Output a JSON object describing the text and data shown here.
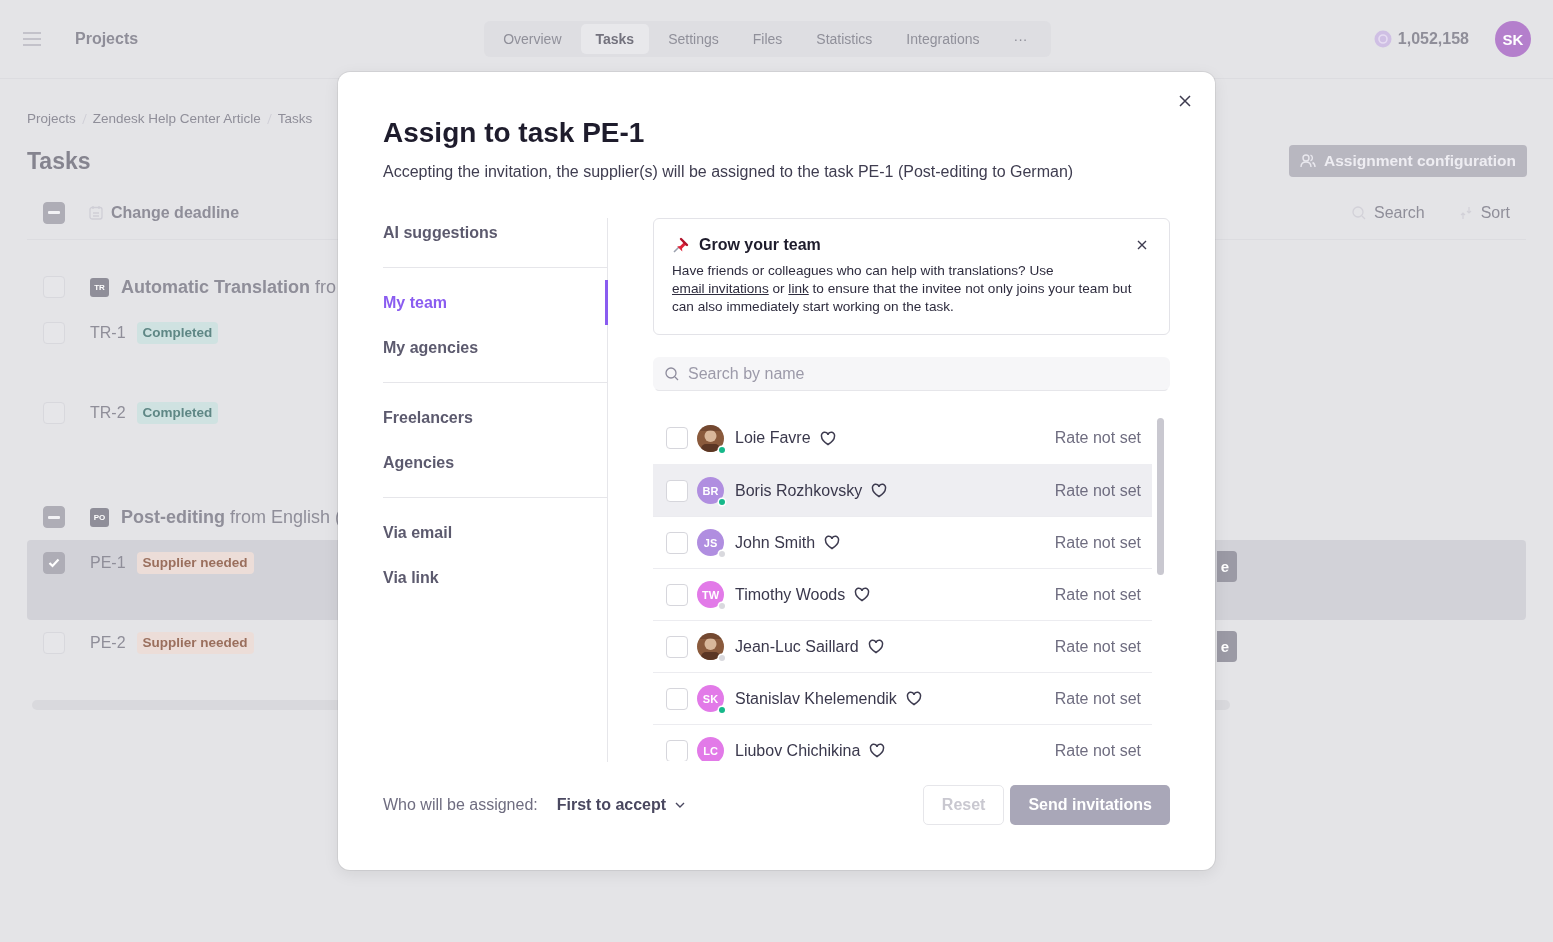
{
  "top_bar": {
    "title": "Projects",
    "tabs": [
      {
        "label": "Overview",
        "selected": false
      },
      {
        "label": "Tasks",
        "selected": true
      },
      {
        "label": "Settings",
        "selected": false
      },
      {
        "label": "Files",
        "selected": false
      },
      {
        "label": "Statistics",
        "selected": false
      },
      {
        "label": "Integrations",
        "selected": false
      },
      {
        "label": "···",
        "selected": false
      }
    ],
    "balance": "1,052,158",
    "avatar": "SK"
  },
  "breadcrumbs": [
    "Projects",
    "Zendesk Help Center Article",
    "Tasks"
  ],
  "page_title": "Tasks",
  "assignment_button": "Assignment configuration",
  "toolbar": {
    "indeterminate": true,
    "action": "Change deadline",
    "search": "Search",
    "sort": "Sort"
  },
  "groups": [
    {
      "badge": "TR",
      "title": "**Automatic Translation** fro",
      "indeterminate": false,
      "rows": [
        {
          "id": "TR-1",
          "status": {
            "text": "Completed",
            "kind": "completed"
          },
          "checked": false,
          "selected": false
        },
        {
          "id": "TR-2",
          "status": {
            "text": "Completed",
            "kind": "completed"
          },
          "checked": false,
          "selected": false
        }
      ]
    },
    {
      "badge": "PO",
      "title": "**Post-editing** from English (",
      "indeterminate": true,
      "rows": [
        {
          "id": "PE-1",
          "status": {
            "text": "Supplier needed",
            "kind": "needed"
          },
          "checked": true,
          "selected": true,
          "button": "e"
        },
        {
          "id": "PE-2",
          "status": {
            "text": "Supplier needed",
            "kind": "needed"
          },
          "checked": false,
          "selected": false,
          "button": "e"
        }
      ]
    }
  ],
  "dialog": {
    "title": "Assign to task PE-1",
    "subtitle": "Accepting the invitation, the supplier(s) will be assigned to the task PE-1 (Post-editing to German)",
    "nav_sections": [
      {
        "items": [
          {
            "label": "AI suggestions",
            "selected": false
          }
        ]
      },
      {
        "items": [
          {
            "label": "My team",
            "selected": true
          },
          {
            "label": "My agencies",
            "selected": false
          }
        ]
      },
      {
        "items": [
          {
            "label": "Freelancers",
            "selected": false
          },
          {
            "label": "Agencies",
            "selected": false
          }
        ]
      },
      {
        "items": [
          {
            "label": "Via email",
            "selected": false
          },
          {
            "label": "Via link",
            "selected": false
          }
        ]
      }
    ],
    "banner": {
      "title": "Grow your team",
      "parts": [
        {
          "kind": "plain",
          "text": "Have friends or colleagues who can help with translations? Use "
        },
        {
          "kind": "link",
          "text": "email invitations"
        },
        {
          "kind": "plain",
          "text": " or "
        },
        {
          "kind": "link",
          "text": "link"
        },
        {
          "kind": "plain",
          "text": " to ensure that the invitee not only joins your team but can also immediately start working on the task."
        }
      ]
    },
    "search_placeholder": "Search by name",
    "people": [
      {
        "name": "Loie Favre",
        "online": true,
        "rate": "Rate not set",
        "checked": false,
        "hovered": false
      },
      {
        "name": "Boris Rozhkovsky",
        "avatar": {
          "kind": "initials",
          "initials": "BR",
          "color": "#b08ee0"
        },
        "online": true,
        "rate": "Rate not set",
        "checked": false,
        "hovered": true
      },
      {
        "name": "John Smith",
        "avatar": {
          "kind": "initials",
          "initials": "JS",
          "color": "#b08ee0"
        },
        "online": false,
        "rate": "Rate not set",
        "checked": false,
        "hovered": false
      },
      {
        "name": "Timothy Woods",
        "avatar": {
          "kind": "initials",
          "initials": "TW",
          "color": "#e27ae8"
        },
        "online": false,
        "rate": "Rate not set",
        "checked": false,
        "hovered": false
      },
      {
        "name": "Jean-Luc Saillard",
        "online": false,
        "rate": "Rate not set",
        "checked": false,
        "hovered": false
      },
      {
        "name": "Stanislav Khelemendik",
        "avatar": {
          "kind": "initials",
          "initials": "SK",
          "color": "#e27ae8"
        },
        "online": true,
        "rate": "Rate not set",
        "checked": false,
        "hovered": false
      },
      {
        "name": "Liubov Chichikina",
        "avatar": {
          "kind": "initials",
          "initials": "LC",
          "color": "#e27ae8"
        },
        "rate": "Rate not set",
        "checked": false,
        "hovered": false
      }
    ],
    "assign_label": "Who will be assigned:",
    "assign_value": "First to accept",
    "buttons": [
      {
        "label": "Reset",
        "kind": "secondary",
        "disabled": true
      },
      {
        "label": "Send invitations",
        "kind": "primary",
        "disabled": true
      }
    ]
  }
}
